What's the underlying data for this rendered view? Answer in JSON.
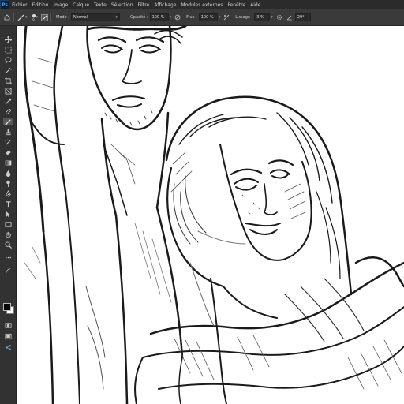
{
  "app": {
    "logo_text": "Ps"
  },
  "menu": {
    "items": [
      {
        "label": "Fichier"
      },
      {
        "label": "Edition"
      },
      {
        "label": "Image"
      },
      {
        "label": "Calque"
      },
      {
        "label": "Texte"
      },
      {
        "label": "Sélection"
      },
      {
        "label": "Filtre"
      },
      {
        "label": "Affichage"
      },
      {
        "label": "Modules externes"
      },
      {
        "label": "Fenêtre"
      },
      {
        "label": "Aide"
      }
    ]
  },
  "options": {
    "brush_size": "6",
    "mode_label": "Mode :",
    "mode_value": "Normal",
    "opacity_label": "Opacité :",
    "opacity_value": "100 %",
    "flow_label": "Flux :",
    "flow_value": "100 %",
    "smoothing_label": "Lissage :",
    "smoothing_value": "3 %",
    "angle_value": "29°"
  },
  "toolbar": {
    "tools": [
      "move-tool",
      "marquee-tool",
      "lasso-tool",
      "magic-wand-tool",
      "crop-tool",
      "frame-tool",
      "eyedropper-tool",
      "healing-brush-tool",
      "brush-tool",
      "clone-stamp-tool",
      "history-brush-tool",
      "eraser-tool",
      "gradient-tool",
      "blur-tool",
      "dodge-tool",
      "pen-tool",
      "type-tool",
      "path-selection-tool",
      "rectangle-tool",
      "hand-tool",
      "zoom-tool",
      "more-tools"
    ],
    "active_tool": "brush-tool",
    "foreground_color": "#000000",
    "background_color": "#ffffff"
  },
  "document": {
    "description": ""
  }
}
